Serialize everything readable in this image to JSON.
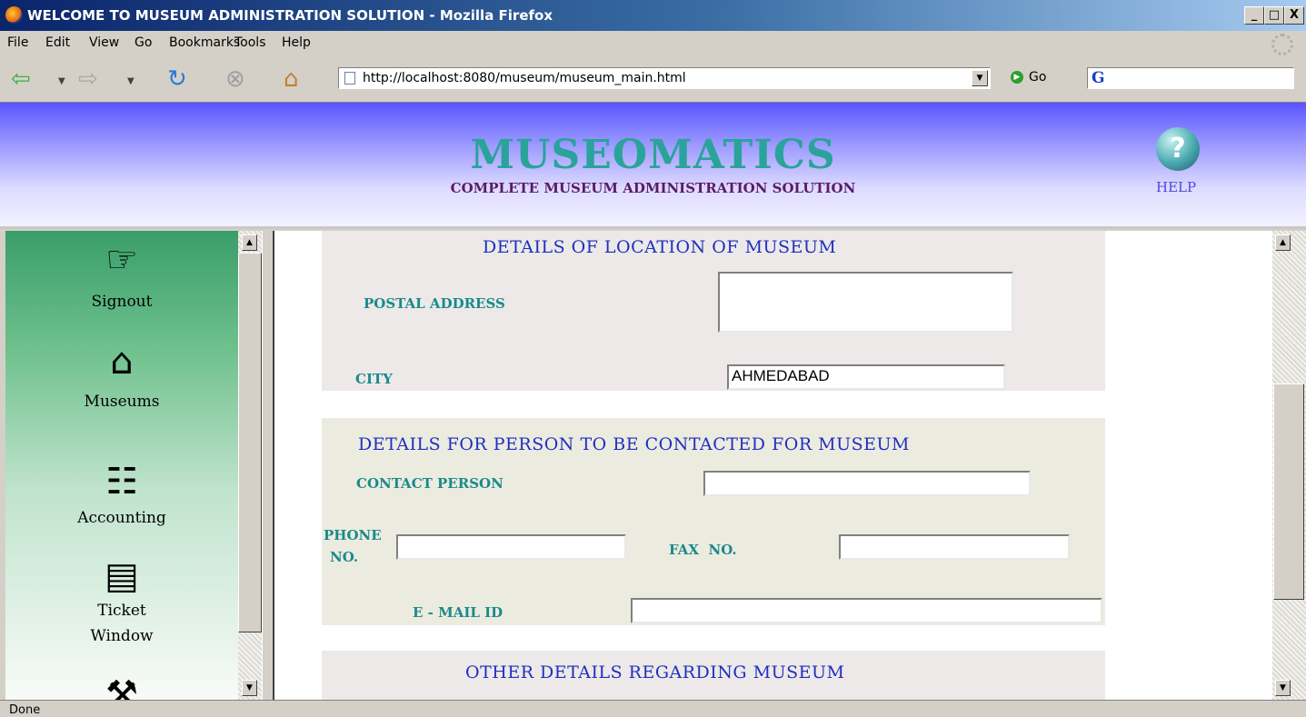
{
  "window": {
    "title": "WELCOME TO MUSEUM ADMINISTRATION SOLUTION - Mozilla Firefox",
    "controls": [
      "_",
      "□",
      "X"
    ]
  },
  "menubar": [
    "File",
    "Edit",
    "View",
    "Go",
    "Bookmarks",
    "Tools",
    "Help"
  ],
  "navbar": {
    "url": "http://localhost:8080/museum/museum_main.html",
    "go_label": "Go",
    "search_logo": "G"
  },
  "header": {
    "brand": "MUSEOMATICS",
    "subtitle": "COMPLETE MUSEUM ADMINISTRATION SOLUTION",
    "help_label": "HELP"
  },
  "sidebar": {
    "items": [
      {
        "label": "Signout",
        "icon": "pointing-hand-icon"
      },
      {
        "label": "Museums",
        "icon": "house-icon"
      },
      {
        "label": "Accounting",
        "icon": "chart-icon"
      },
      {
        "label": "Ticket",
        "label2": "Window",
        "icon": "ticket-window-icon"
      },
      {
        "label": "",
        "icon": "wrench-icon"
      }
    ]
  },
  "location": {
    "heading": "DETAILS OF LOCATION OF MUSEUM",
    "postal_label": "POSTAL ADDRESS",
    "postal_value": "",
    "city_label": "CITY",
    "city_value": "AHMEDABAD"
  },
  "contact": {
    "heading": "DETAILS FOR PERSON TO BE CONTACTED FOR MUSEUM",
    "person_label": "CONTACT PERSON",
    "person_value": "",
    "phone_label_1": "PHONE",
    "phone_label_2": "NO.",
    "phone_value": "",
    "fax_label": "FAX  NO.",
    "fax_value": "",
    "email_label": "E - MAIL ID",
    "email_value": ""
  },
  "other": {
    "heading": "OTHER DETAILS REGARDING MUSEUM"
  },
  "status": {
    "text": "Done"
  },
  "colors": {
    "brand": "#2aa39a",
    "subtitle": "#5a1a6a",
    "section_heading": "#1f2fbf",
    "field_label": "#1a8a8a"
  }
}
